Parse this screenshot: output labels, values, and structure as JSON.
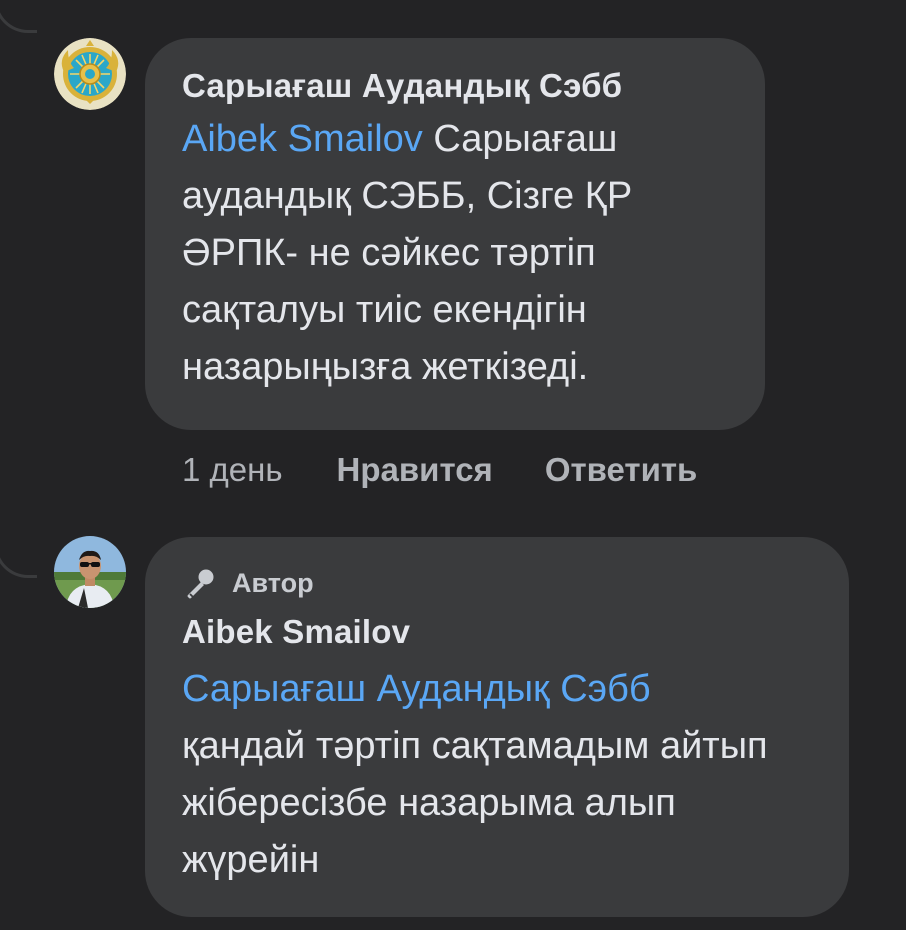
{
  "comments": [
    {
      "author": "Сарыағаш Аудандық Сэбб",
      "mention": "Aibek Smailov",
      "text": " Сарыағаш аудандық СЭББ, Сізге ҚР ӘРПК- не сәйкес тәртіп сақталуы тиіс екендігін назарыңызға жеткізеді.",
      "time": "1 день",
      "like_label": "Нравится",
      "reply_label": "Ответить",
      "avatar_icon": "kazakhstan-emblem-icon"
    },
    {
      "badge_label": "Автор",
      "badge_icon": "microphone-icon",
      "author": "Aibek Smailov",
      "mention": "Сарыағаш Аудандық Сэбб",
      "text": "қандай тәртіп сақтамадым айтып жібересізбе назарыма алып жүрейін",
      "avatar_icon": "user-photo-avatar"
    }
  ],
  "colors": {
    "background": "#232325",
    "bubble": "#3a3b3d",
    "text": "#e4e6eb",
    "mention": "#5aa7f5",
    "meta": "#b0b3b8"
  }
}
